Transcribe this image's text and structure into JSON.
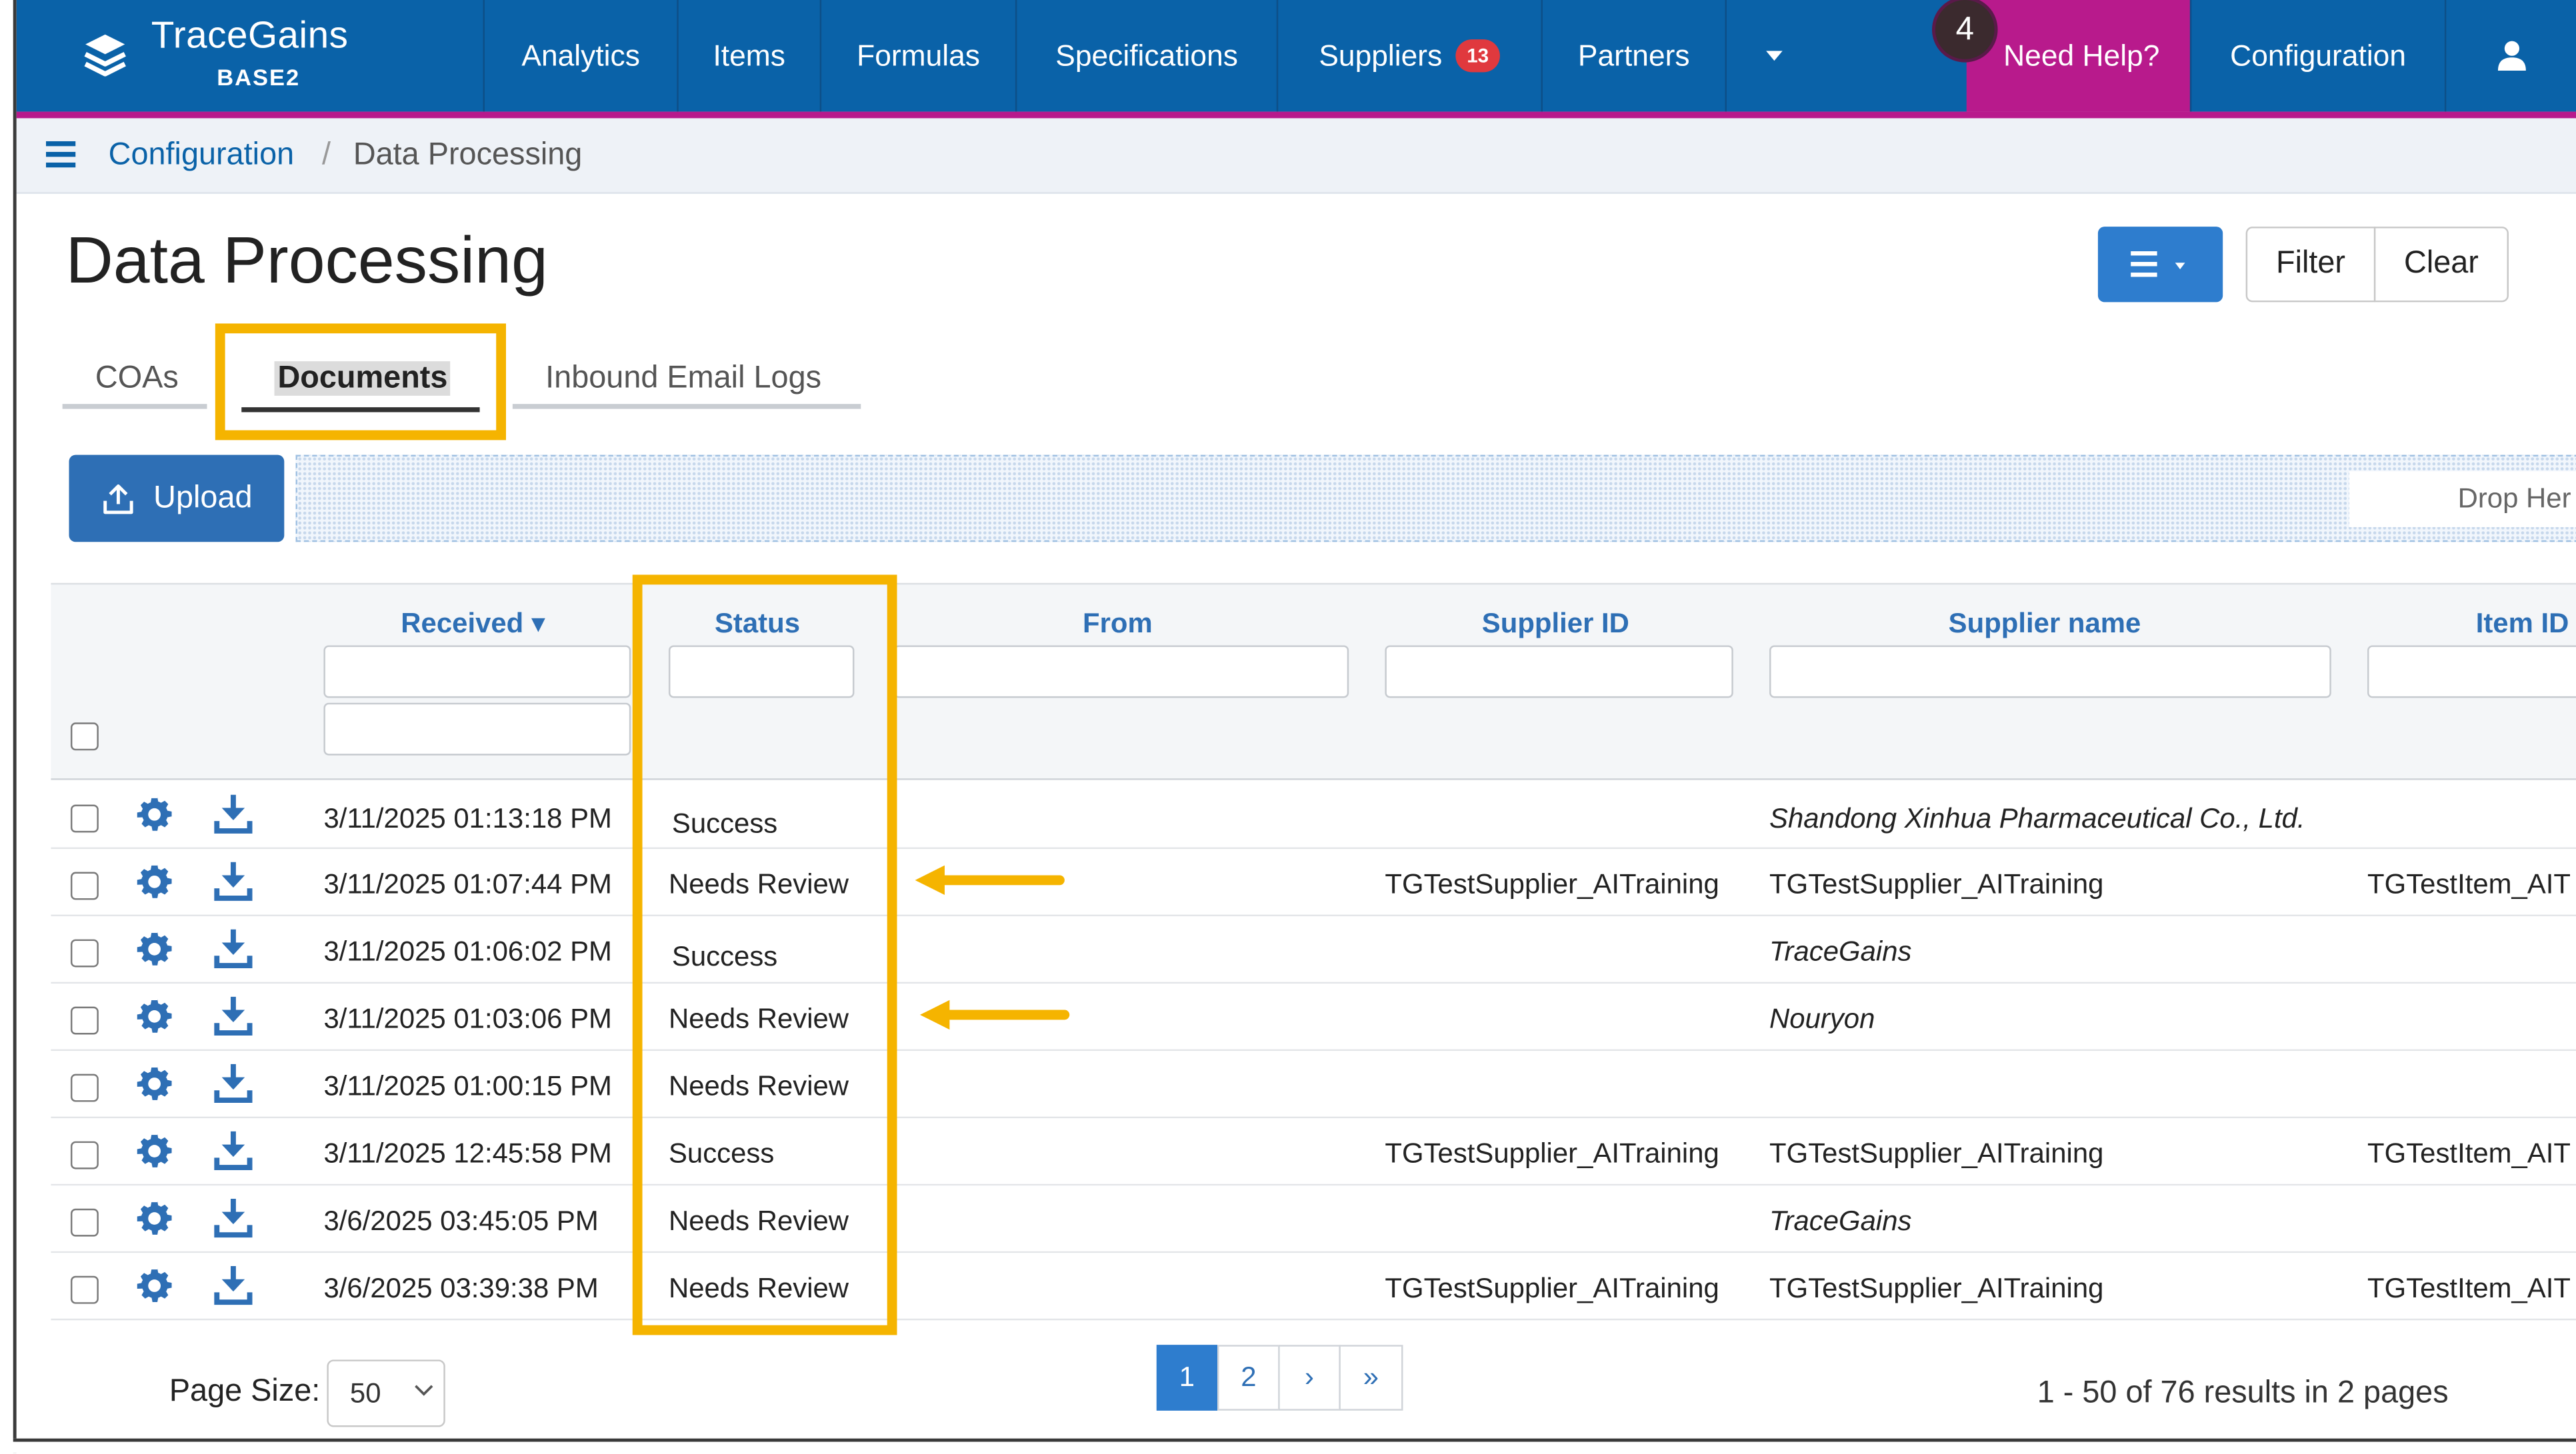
{
  "app": {
    "name": "TraceGains",
    "environment": "BASE2"
  },
  "nav": {
    "items": [
      "Analytics",
      "Items",
      "Formulas",
      "Specifications",
      "Suppliers",
      "Partners"
    ],
    "suppliers_badge": "13",
    "help_label": "Need Help?",
    "help_count": "4",
    "configuration_label": "Configuration",
    "icons": [
      "stack-logo-icon",
      "caret-down-icon",
      "user-icon"
    ]
  },
  "breadcrumb": {
    "parent": "Configuration",
    "separator": "/",
    "current": "Data Processing"
  },
  "page": {
    "title": "Data Processing",
    "filter_label": "Filter",
    "clear_label": "Clear"
  },
  "tabs": [
    {
      "label": "COAs",
      "active": false
    },
    {
      "label": "Documents",
      "active": true
    },
    {
      "label": "Inbound Email Logs",
      "active": false
    }
  ],
  "upload": {
    "label": "Upload",
    "dropzone_label": "Drop Her"
  },
  "table": {
    "columns": [
      "Received ▾",
      "Status",
      "From",
      "Supplier ID",
      "Supplier name",
      "Item ID"
    ],
    "rows": [
      {
        "received": "3/11/2025 01:13:18 PM",
        "status": "Success",
        "from": "",
        "supplier_id": "",
        "supplier_name": "Shandong Xinhua Pharmaceutical Co., Ltd.",
        "item_id": ""
      },
      {
        "received": "3/11/2025 01:07:44 PM",
        "status": "Needs Review",
        "from": "",
        "supplier_id": "TGTestSupplier_AITraining",
        "supplier_name": "TGTestSupplier_AITraining",
        "item_id": "TGTestItem_AIT"
      },
      {
        "received": "3/11/2025 01:06:02 PM",
        "status": "Success",
        "from": "",
        "supplier_id": "",
        "supplier_name": "TraceGains",
        "item_id": ""
      },
      {
        "received": "3/11/2025 01:03:06 PM",
        "status": "Needs Review",
        "from": "",
        "supplier_id": "",
        "supplier_name": "Nouryon",
        "item_id": ""
      },
      {
        "received": "3/11/2025 01:00:15 PM",
        "status": "Needs Review",
        "from": "",
        "supplier_id": "",
        "supplier_name": "",
        "item_id": ""
      },
      {
        "received": "3/11/2025 12:45:58 PM",
        "status": "Success",
        "from": "",
        "supplier_id": "TGTestSupplier_AITraining",
        "supplier_name": "TGTestSupplier_AITraining",
        "item_id": "TGTestItem_AIT"
      },
      {
        "received": "3/6/2025 03:45:05 PM",
        "status": "Needs Review",
        "from": "",
        "supplier_id": "",
        "supplier_name": "TraceGains",
        "item_id": ""
      },
      {
        "received": "3/6/2025 03:39:38 PM",
        "status": "Needs Review",
        "from": "",
        "supplier_id": "TGTestSupplier_AITraining",
        "supplier_name": "TGTestSupplier_AITraining",
        "item_id": "TGTestItem_AIT"
      }
    ]
  },
  "footer": {
    "page_size_label": "Page Size:",
    "page_size_value": "50",
    "pages": [
      "1",
      "2",
      "›",
      "»"
    ],
    "results_text": "1 - 50 of 76 results in 2 pages"
  },
  "colors": {
    "nav_blue": "#0a62a8",
    "help_magenta": "#b81a8c",
    "highlight_yellow": "#f5b400",
    "link_blue": "#2e6fb5"
  }
}
